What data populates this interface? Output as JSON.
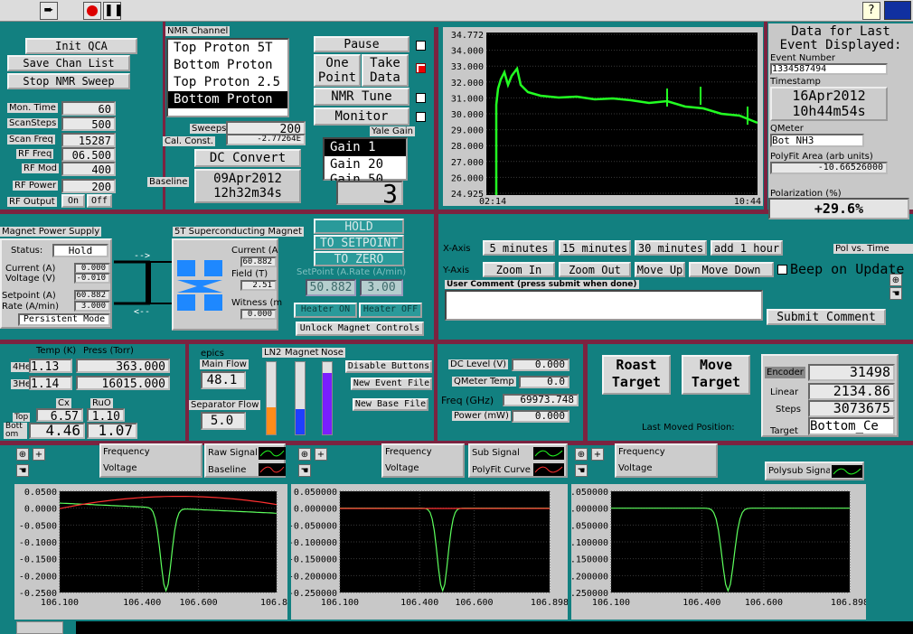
{
  "toolbar": {
    "run_icon": "run-arrow-icon",
    "stop_icon": "stop-icon",
    "pause_icon": "pause-icon",
    "help_icon": "help-icon"
  },
  "left_controls": {
    "init_qca": "Init QCA",
    "save_chan_list": "Save Chan List",
    "stop_nmr_sweep": "Stop NMR Sweep",
    "mon_time_label": "Mon. Time",
    "mon_time": "60",
    "scansteps_label": "ScanSteps",
    "scansteps": "500",
    "scan_freq_label": "Scan Freq",
    "scan_freq": "15287",
    "rf_freq_label": "RF Freq",
    "rf_freq": "06.500",
    "rf_mod_label": "RF Mod",
    "rf_mod": "400",
    "rf_power_label": "RF Power",
    "rf_power": "200",
    "rf_output_label": "RF Output",
    "rf_on": "On",
    "rf_off": "Off"
  },
  "nmr_channel": {
    "label": "NMR Channel",
    "items": [
      "Top Proton 5T",
      "Bottom Proton",
      "Top Proton 2.5",
      "Bottom Proton"
    ],
    "selected_index": 3,
    "sweeps_label": "Sweeps",
    "sweeps": "200",
    "cal_const_label": "Cal. Const.",
    "cal_const": "-2.77264E",
    "dc_convert": "DC Convert",
    "baseline_label": "Baseline",
    "baseline_date": "09Apr2012",
    "baseline_time": "12h32m34s"
  },
  "run_buttons": {
    "pause": "Pause",
    "one_point": [
      "One",
      "Point"
    ],
    "take_data": [
      "Take",
      "Data"
    ],
    "nmr_tune": "NMR Tune",
    "monitor": "Monitor"
  },
  "yale_gain": {
    "label": "Yale Gain",
    "items": [
      "Gain 1",
      "Gain 20",
      "Gain 50"
    ],
    "selected_index": 0,
    "display": "3"
  },
  "top_chart": {
    "y_ticks": [
      "34.772",
      "34.000",
      "33.000",
      "32.000",
      "31.000",
      "30.000",
      "29.000",
      "28.000",
      "27.000",
      "26.000",
      "24.925"
    ],
    "x_left_time": "02:14",
    "x_left_date": "04/16/12",
    "x_right_time": "10:44",
    "x_right_date": "04/16/12",
    "trace_color": "#22ff22"
  },
  "event_panel": {
    "title_line1": "Data for Last",
    "title_line2": "Event Displayed:",
    "event_number_label": "Event Number",
    "event_number": "1334587494",
    "timestamp_label": "Timestamp",
    "ts_date": "16Apr2012",
    "ts_time": "10h44m54s",
    "qmeter_label": "QMeter",
    "qmeter": "Bot NH3",
    "polyfit_label": "PolyFit Area (arb units)",
    "polyfit": "-10.66526000",
    "polarization_label": "Polarization (%)",
    "polarization": "+29.6%"
  },
  "axis_controls": {
    "x_axis_label": "X-Axis",
    "x_buttons": [
      "5 minutes",
      "15 minutes",
      "30 minutes",
      "add 1 hour"
    ],
    "y_axis_label": "Y-Axis",
    "y_buttons": [
      "Zoom In",
      "Zoom Out",
      "Move Up",
      "Move Down"
    ],
    "pol_vs_time": "Pol vs. Time",
    "beep_label": "Beep on Update",
    "comment_label": "User Comment (press submit when done)",
    "comment_value": "",
    "submit_comment": "Submit Comment"
  },
  "magnet_supply": {
    "title": "Magnet Power Supply",
    "status_label": "Status:",
    "status": "Hold",
    "current_label": "Current (A)",
    "current": "0.000",
    "voltage_label": "Voltage (V)",
    "voltage": "-0.010",
    "setpoint_label": "Setpoint (A)",
    "setpoint": "60.882",
    "rate_label": "Rate (A/min)",
    "rate": "3.000",
    "mode": "Persistent Mode"
  },
  "sc_magnet": {
    "title": "5T Superconducting Magnet",
    "current_label": "Current (A",
    "current": "60.882",
    "field_label": "Field (T)",
    "field": "2.51",
    "witness_label": "Witness (m",
    "witness": "0.000",
    "hold": "HOLD",
    "to_setpoint": "TO SETPOINT",
    "to_zero": "TO ZERO",
    "setpoint_rate_label": "SetPoint (A.Rate (A/min)",
    "setpoint": "50.882",
    "rate": "3.00",
    "heater_on": "Heater ON",
    "heater_off": "Heater OFF",
    "unlock": "Unlock Magnet Controls"
  },
  "temp_section": {
    "temp_label": "Temp (K)",
    "press_label": "Press (Torr)",
    "he4_label": "4He",
    "he4_temp": "1.13",
    "he4_press": "363.000",
    "he3_label": "3He",
    "he3_temp": "1.14",
    "he3_press": "16015.000",
    "cx_label": "Cx",
    "ruo_label": "RuO",
    "top_label": "Top",
    "top_cx": "6.57",
    "top_ruo": "1.10",
    "bottom_label": "Bott om",
    "bottom_cx": "4.46",
    "bottom_ruo": "1.07"
  },
  "flow_section": {
    "epics": "epics",
    "main_flow_label": "Main Flow",
    "main_flow": "48.1",
    "sep_flow_label": "Separator Flow",
    "sep_flow": "5.0",
    "ln2_label": "LN2",
    "magnet_label": "Magnet",
    "nose_label": "Nose",
    "ln2_level": 0.38,
    "magnet_level": 0.35,
    "nose_level": 0.85,
    "ln2_color": "#ff8c1a",
    "magnet_color": "#1f3fff",
    "nose_color": "#7a1fff",
    "disable_buttons": "Disable Buttons",
    "new_event_file": "New Event File",
    "new_base_file": "New Base File"
  },
  "dc_section": {
    "dc_level_label": "DC Level (V)",
    "dc_level": "0.000",
    "qmeter_temp_label": "QMeter Temp",
    "qmeter_temp": "0.0",
    "freq_label": "Freq (GHz)",
    "freq": "69973.748",
    "power_label": "Power (mW)",
    "power": "0.000"
  },
  "target_section": {
    "roast": [
      "Roast",
      "Target"
    ],
    "move": [
      "Move",
      "Target"
    ],
    "encoder_label": "Encoder",
    "encoder": "31498",
    "linear_label": "Linear",
    "linear": "2134.86",
    "steps_label": "Steps",
    "steps": "3073675",
    "target_label": "Target",
    "target": "Bottom_Ce",
    "last_moved": "Last Moved Position:"
  },
  "bottom_legends": {
    "frequency": "Frequency",
    "voltage": "Voltage",
    "raw_signal": "Raw Signal",
    "baseline": "Baseline",
    "sub_signal": "Sub Signal",
    "polyfit_curve": "PolyFit Curve",
    "polysub_signal": "Polysub Signal",
    "raw_color": "#22ff22",
    "baseline_color": "#ff3030"
  },
  "chart_data": [
    {
      "type": "line",
      "title": "",
      "y_ticks": [
        "0.0500",
        "0.0000",
        "-0.0500",
        "-0.1000",
        "-0.1500",
        "-0.2000",
        "-0.2500"
      ],
      "x_ticks": [
        "106.100",
        "106.400",
        "106.600",
        "106.89"
      ],
      "ylim": [
        -0.25,
        0.05
      ],
      "series": [
        {
          "name": "Raw Signal"
        },
        {
          "name": "Baseline"
        }
      ]
    },
    {
      "type": "line",
      "title": "",
      "y_ticks": [
        "0.050000",
        "0.000000",
        "-0.050000",
        "-0.100000",
        "-0.150000",
        "-0.200000",
        "-0.250000"
      ],
      "x_ticks": [
        "106.100",
        "106.400",
        "106.600",
        "106.898"
      ],
      "ylim": [
        -0.25,
        0.05
      ],
      "series": [
        {
          "name": "Sub Signal"
        },
        {
          "name": "PolyFit Curve"
        }
      ]
    },
    {
      "type": "line",
      "title": "",
      "y_ticks": [
        "0.050000",
        "0.000000",
        "-0.050000",
        "-0.100000",
        "-0.150000",
        "-0.200000",
        "-0.250000"
      ],
      "x_ticks": [
        "106.100",
        "106.400",
        "106.600",
        "106.898"
      ],
      "ylim": [
        -0.25,
        0.05
      ],
      "series": [
        {
          "name": "Polysub Signal"
        }
      ]
    }
  ]
}
